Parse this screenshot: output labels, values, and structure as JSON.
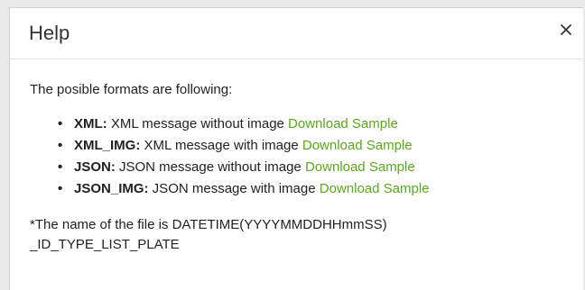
{
  "dialog": {
    "title": "Help",
    "close_glyph": "✕",
    "close_icon": "close-icon"
  },
  "content": {
    "intro": "The posible formats are following:",
    "bullet_glyph": "•",
    "formats": [
      {
        "name": "XML:",
        "description": " XML message without image ",
        "link": "Download Sample"
      },
      {
        "name": "XML_IMG:",
        "description": " XML message with image ",
        "link": "Download Sample"
      },
      {
        "name": "JSON:",
        "description": " JSON message without image ",
        "link": "Download Sample"
      },
      {
        "name": "JSON_IMG:",
        "description": " JSON message with image ",
        "link": "Download Sample"
      }
    ],
    "note_line1": "*The name of the file is DATETIME(YYYYMMDDHHmmSS)",
    "note_line2": "_ID_TYPE_LIST_PLATE"
  },
  "colors": {
    "link": "#5aa81e",
    "text": "#222222",
    "title": "#333333"
  }
}
